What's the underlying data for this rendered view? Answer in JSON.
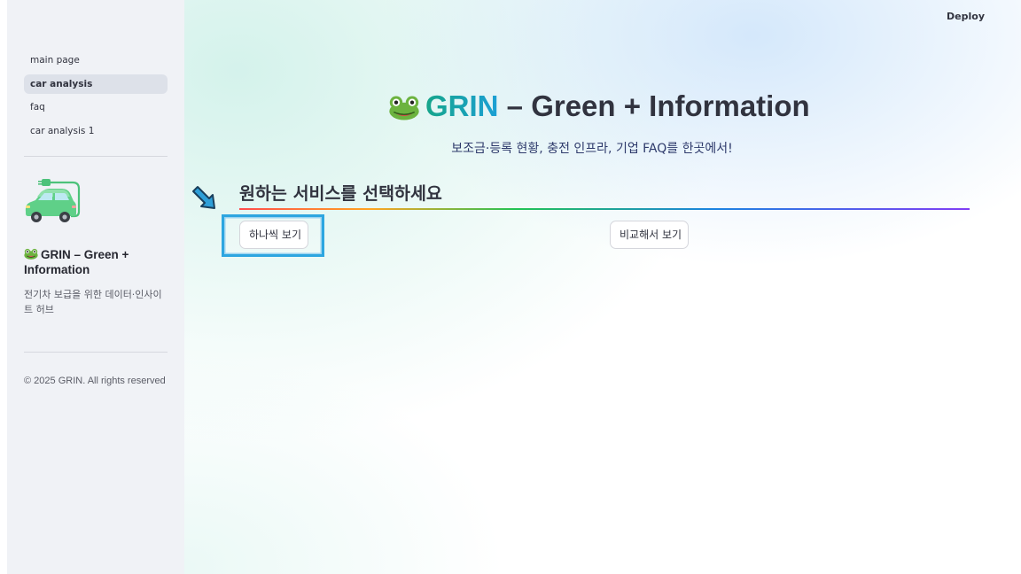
{
  "header": {
    "deploy_label": "Deploy"
  },
  "sidebar": {
    "items": [
      {
        "label": "main page",
        "active": false
      },
      {
        "label": "car analysis",
        "active": true
      },
      {
        "label": "faq",
        "active": false
      },
      {
        "label": "car analysis 1",
        "active": false
      }
    ],
    "logo_icon": "ev-car-charging-icon",
    "title_icon": "frog-icon",
    "title": "GRIN – Green + Information",
    "description": "전기차 보급을 위한 데이터·인사이트 허브",
    "copyright": "© 2025 GRIN. All rights reserved"
  },
  "main": {
    "hero": {
      "icon": "frog-icon",
      "brand": "GRIN",
      "rest": " – Green + Information"
    },
    "subtitle": "보조금·등록 현황, 충전 인프라, 기업 FAQ를 한곳에서!",
    "section_icon": "arrow-down-right-icon",
    "section_heading": "원하는 서비스를 선택하세요",
    "buttons": {
      "one_by_one": "하나씩 보기",
      "compare": "비교해서 보기"
    }
  },
  "colors": {
    "brand_gradient_start": "#16a58a",
    "brand_gradient_end": "#1b9fd6",
    "focus_outline": "#2da6e0",
    "sidebar_bg": "#f0f2f6",
    "active_nav_bg": "#dde1e9"
  }
}
